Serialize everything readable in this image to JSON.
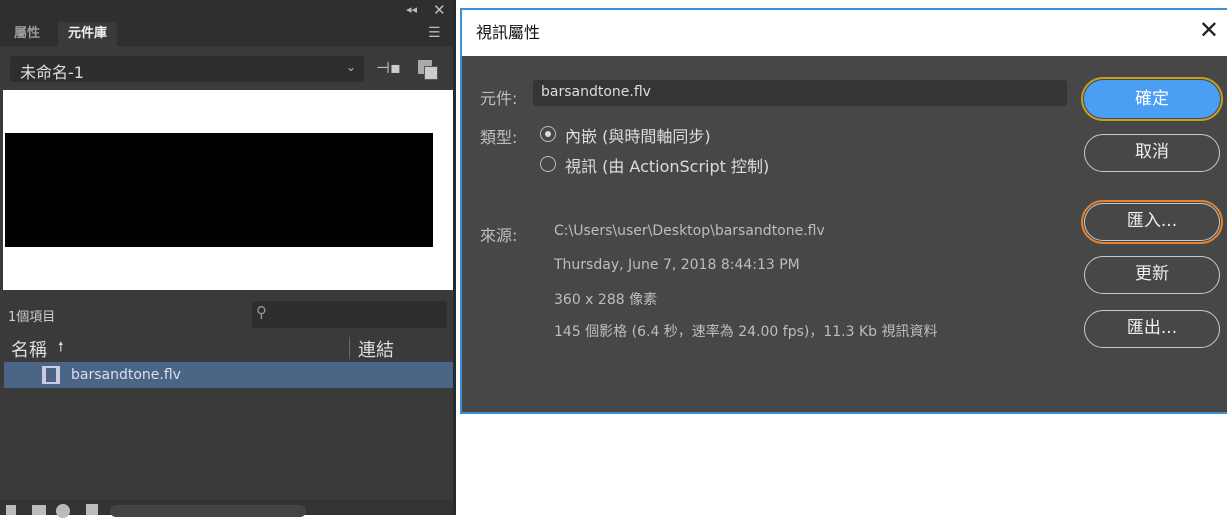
{
  "library_panel": {
    "tabs": [
      "屬性",
      "元件庫"
    ],
    "document_select": "未命名-1",
    "item_count": "1個項目",
    "search_placeholder": "",
    "columns": {
      "name": "名稱",
      "linkage": "連結"
    },
    "items": [
      {
        "name": "barsandtone.flv",
        "icon": "video-icon"
      }
    ]
  },
  "dialog": {
    "title": "視訊屬性",
    "symbol_label": "元件:",
    "symbol_value": "barsandtone.flv",
    "type_label": "類型:",
    "type_options": [
      {
        "label": "內嵌 (與時間軸同步)",
        "selected": true
      },
      {
        "label": "視訊 (由 ActionScript 控制)",
        "selected": false
      }
    ],
    "source_label": "來源:",
    "source_path": "C:\\Users\\user\\Desktop\\barsandtone.flv",
    "source_date": "Thursday, June 7, 2018  8:44:13 PM",
    "source_dims": "360 x 288 像素",
    "source_info": "145 個影格 (6.4 秒，速率為 24.00 fps)，11.3 Kb 視訊資料",
    "buttons": {
      "ok": "確定",
      "cancel": "取消",
      "import": "匯入...",
      "update": "更新",
      "export": "匯出..."
    }
  },
  "colors": {
    "accent": "#4a9ff5",
    "highlight": "#e8822e",
    "focus": "#c8a020",
    "selected_row": "#4a6585"
  }
}
